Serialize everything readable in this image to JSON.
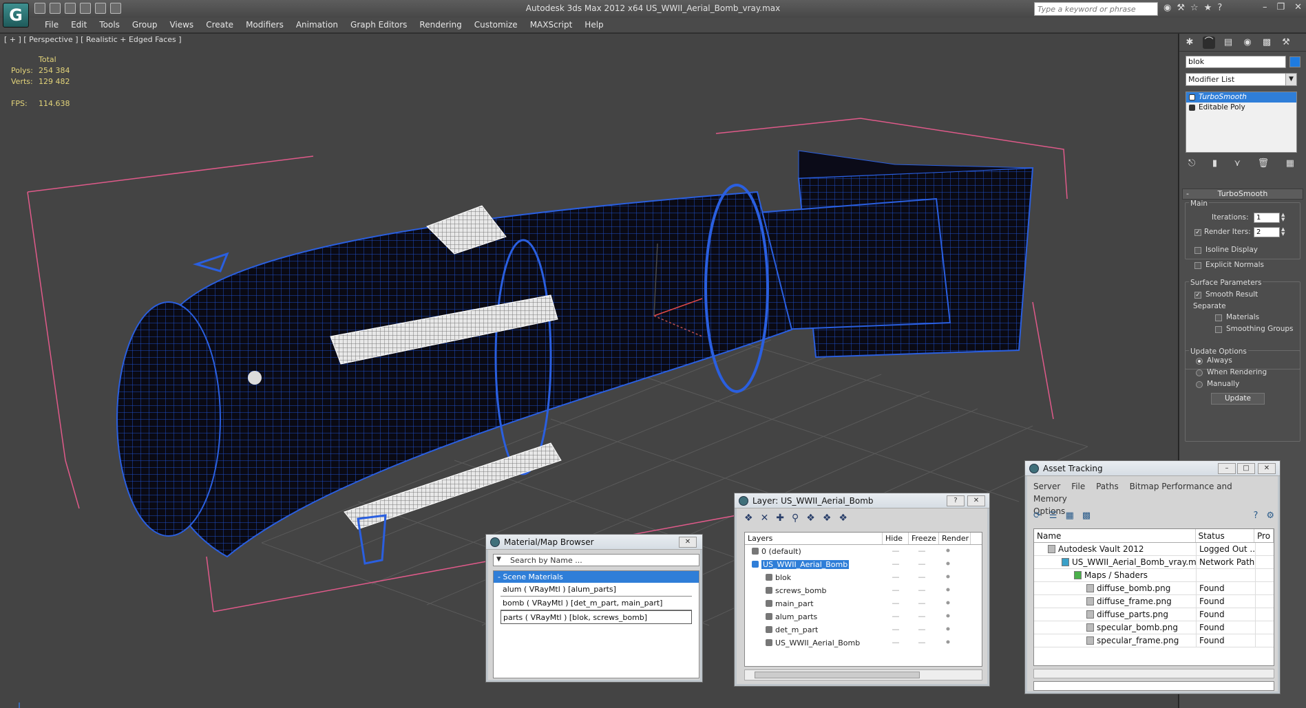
{
  "window": {
    "title": "Autodesk 3ds Max  2012 x64     US_WWII_Aerial_Bomb_vray.max",
    "search_placeholder": "Type a keyword or phrase"
  },
  "menu": [
    "File",
    "Edit",
    "Tools",
    "Group",
    "Views",
    "Create",
    "Modifiers",
    "Animation",
    "Graph Editors",
    "Rendering",
    "Customize",
    "MAXScript",
    "Help"
  ],
  "viewport": {
    "label": "[ + ] [ Perspective ] [ Realistic + Edged Faces ]",
    "stats": {
      "total_label": "Total",
      "polys_label": "Polys:",
      "polys": "254 384",
      "verts_label": "Verts:",
      "verts": "129 482",
      "fps_label": "FPS:",
      "fps": "114.638"
    }
  },
  "command_panel": {
    "object_name": "blok",
    "object_color": "#1e7be0",
    "modifier_list": "Modifier List",
    "stack": [
      "TurboSmooth",
      "Editable Poly"
    ],
    "rollout": "TurboSmooth",
    "main_label": "Main",
    "iterations_label": "Iterations:",
    "iterations": "1",
    "render_iters_label": "Render Iters:",
    "render_iters": "2",
    "isoline_label": "Isoline Display",
    "explicit_normals_label": "Explicit Normals",
    "surface_params_label": "Surface Parameters",
    "smooth_result_label": "Smooth Result",
    "separate_label": "Separate",
    "materials_label": "Materials",
    "smoothing_groups_label": "Smoothing Groups",
    "update_options_label": "Update Options",
    "always_label": "Always",
    "when_rendering_label": "When Rendering",
    "manually_label": "Manually",
    "update_button": "Update"
  },
  "material_browser": {
    "title": "Material/Map Browser",
    "search_placeholder": "Search by Name ...",
    "group": "- Scene Materials",
    "items": [
      "alum  ( VRayMtl ) [alum_parts]",
      "bomb  ( VRayMtl ) [det_m_part, main_part]",
      "parts  ( VRayMtl ) [blok, screws_bomb]"
    ]
  },
  "layer_dialog": {
    "title": "Layer: US_WWII_Aerial_Bomb",
    "headers": [
      "Layers",
      "Hide",
      "Freeze",
      "Render"
    ],
    "rows": [
      {
        "name": "0 (default)"
      },
      {
        "name": "US_WWII_Aerial_Bomb"
      },
      {
        "name": "blok"
      },
      {
        "name": "screws_bomb"
      },
      {
        "name": "main_part"
      },
      {
        "name": "alum_parts"
      },
      {
        "name": "det_m_part"
      },
      {
        "name": "US_WWII_Aerial_Bomb"
      }
    ]
  },
  "asset_tracking": {
    "title": "Asset Tracking",
    "menu": [
      "Server",
      "File",
      "Paths",
      "Bitmap Performance and Memory",
      "Options"
    ],
    "headers": [
      "Name",
      "Status",
      "Pro"
    ],
    "rows": [
      {
        "name": "Autodesk Vault 2012",
        "status": "Logged Out ..."
      },
      {
        "name": "US_WWII_Aerial_Bomb_vray.max",
        "status": "Network Path"
      },
      {
        "name": "Maps / Shaders",
        "status": ""
      },
      {
        "name": "diffuse_bomb.png",
        "status": "Found"
      },
      {
        "name": "diffuse_frame.png",
        "status": "Found"
      },
      {
        "name": "diffuse_parts.png",
        "status": "Found"
      },
      {
        "name": "specular_bomb.png",
        "status": "Found"
      },
      {
        "name": "specular_frame.png",
        "status": "Found"
      }
    ]
  }
}
